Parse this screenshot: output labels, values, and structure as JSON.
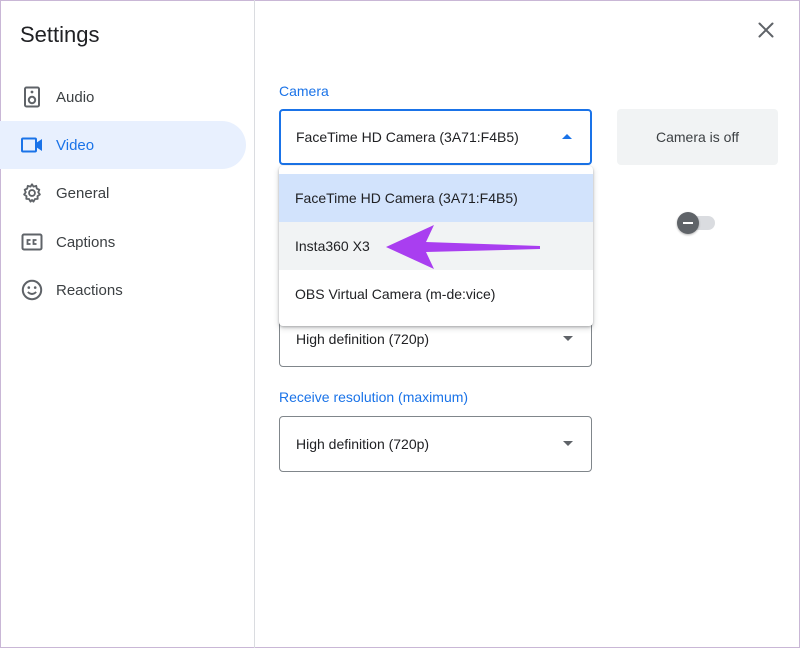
{
  "sidebar": {
    "title": "Settings",
    "items": [
      {
        "label": "Audio",
        "icon": "speaker-icon",
        "active": false
      },
      {
        "label": "Video",
        "icon": "video-camera-icon",
        "active": true
      },
      {
        "label": "General",
        "icon": "gear-icon",
        "active": false
      },
      {
        "label": "Captions",
        "icon": "closed-captions-icon",
        "active": false
      },
      {
        "label": "Reactions",
        "icon": "smiley-icon",
        "active": false
      }
    ]
  },
  "main": {
    "camera": {
      "label": "Camera",
      "selected": "FaceTime HD Camera (3A71:F4B5)",
      "options": [
        "FaceTime HD Camera (3A71:F4B5)",
        "Insta360 X3",
        "OBS Virtual Camera (m-de:vice)"
      ]
    },
    "preview": {
      "status": "Camera is off"
    },
    "send_resolution": {
      "value": "High definition (720p)"
    },
    "receive_resolution": {
      "label": "Receive resolution (maximum)",
      "value": "High definition (720p)"
    }
  },
  "colors": {
    "accent": "#1a73e8",
    "active_nav_bg": "#e8f0fe",
    "selected_option_bg": "#d2e3fc",
    "annotation_arrow": "#a93ef0"
  }
}
